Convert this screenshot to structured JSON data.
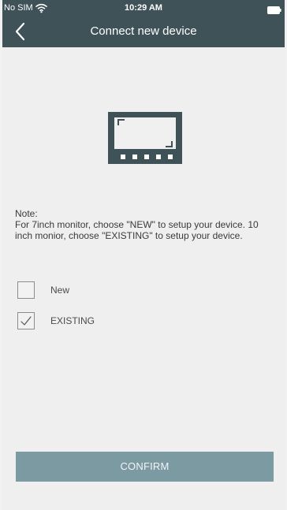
{
  "status_bar": {
    "carrier": "No SIM",
    "time": "10:29 AM"
  },
  "header": {
    "title": "Connect new device",
    "back_icon": "chevron-left-icon"
  },
  "illustration": {
    "icon": "monitor-icon"
  },
  "note": {
    "title": "Note:",
    "text": "For 7inch monitor, choose \"NEW\" to setup your device. 10 inch monior, choose \"EXISTING\" to setup your device."
  },
  "options": [
    {
      "label": "New",
      "checked": false
    },
    {
      "label": "EXISTING",
      "checked": true
    }
  ],
  "actions": {
    "confirm_label": "CONFIRM"
  },
  "colors": {
    "header_background": "#3e5258",
    "page_background": "#efefef",
    "monitor_frame": "#3e5258",
    "confirm_button": "#7b9aa1"
  }
}
